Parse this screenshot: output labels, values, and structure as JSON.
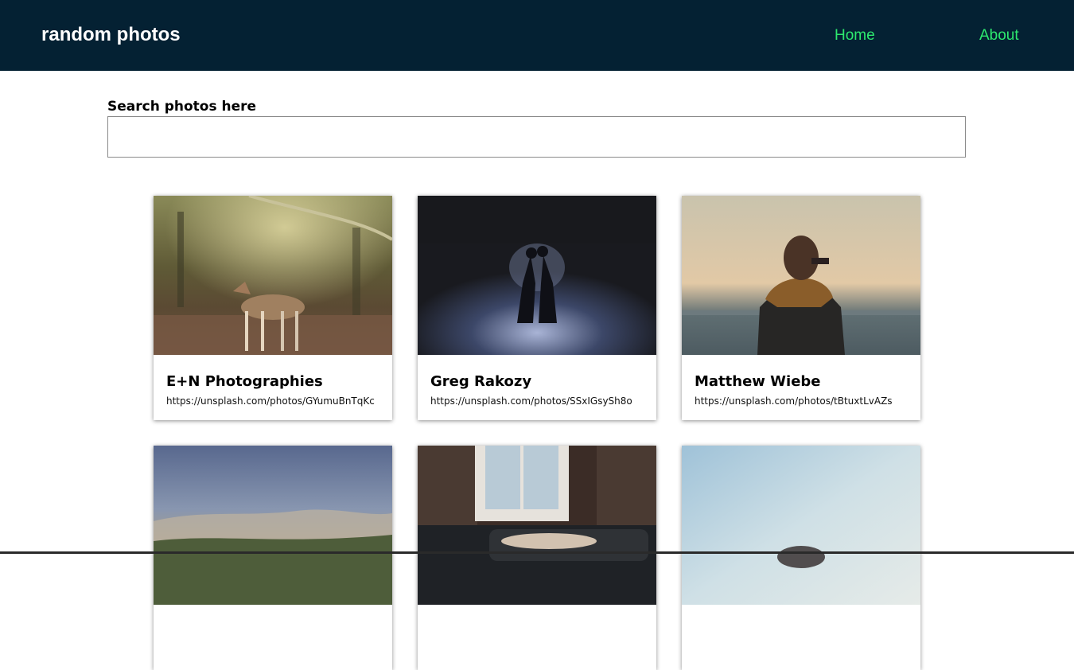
{
  "header": {
    "brand": "random photos",
    "nav": [
      {
        "label": "Home"
      },
      {
        "label": "About"
      }
    ],
    "background": "#042133",
    "link_color": "#2de86e"
  },
  "search": {
    "label": "Search photos here",
    "value": "",
    "placeholder": ""
  },
  "photos": [
    {
      "author": "E+N Photographies",
      "url": "https://unsplash.com/photos/GYumuBnTqKc",
      "subject": "fawn in autumn forest"
    },
    {
      "author": "Greg Rakozy",
      "url": "https://unsplash.com/photos/SSxIGsySh8o",
      "subject": "couple in snowy night light"
    },
    {
      "author": "Matthew Wiebe",
      "url": "https://unsplash.com/photos/tBtuxtLvAZs",
      "subject": "person in scarf by the sea"
    },
    {
      "author": "",
      "url": "",
      "subject": "misty hills under cloudy sky"
    },
    {
      "author": "",
      "url": "",
      "subject": "person lying on sofa by window"
    },
    {
      "author": "",
      "url": "",
      "subject": "pale blue sky"
    }
  ]
}
